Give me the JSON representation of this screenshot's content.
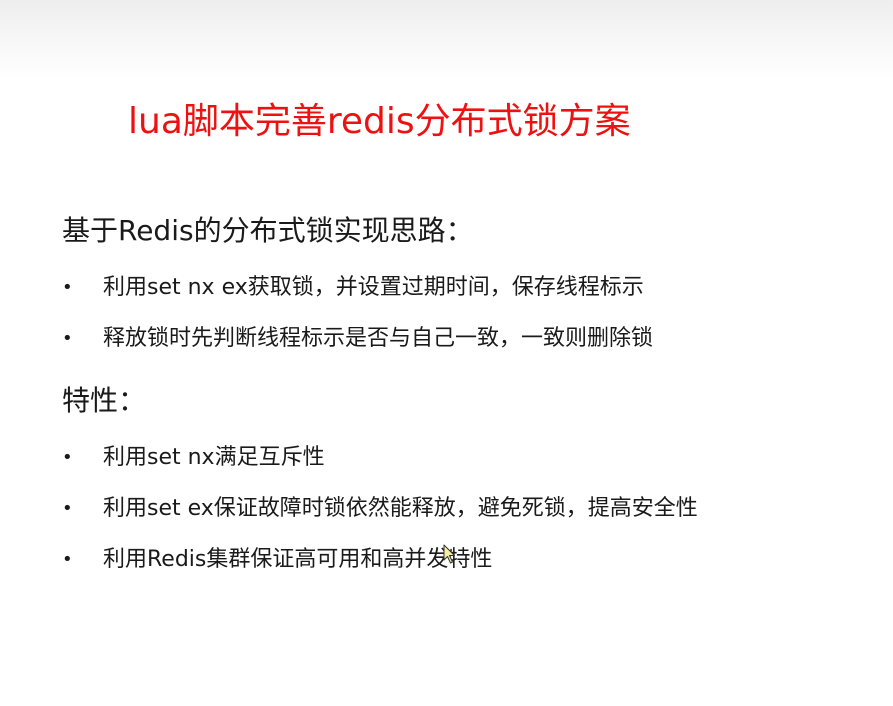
{
  "slide": {
    "title": "lua脚本完善redis分布式锁方案",
    "sections": [
      {
        "heading": "基于Redis的分布式锁实现思路：",
        "bullets": [
          "利用set nx ex获取锁，并设置过期时间，保存线程标示",
          "释放锁时先判断线程标示是否与自己一致，一致则删除锁"
        ]
      },
      {
        "heading": "特性：",
        "bullets": [
          "利用set nx满足互斥性",
          "利用set ex保证故障时锁依然能释放，避免死锁，提高安全性",
          "利用Redis集群保证高可用和高并发特性"
        ]
      }
    ]
  },
  "bullet_glyph": "•",
  "colors": {
    "title": "#ee1111",
    "text": "#1a1a1a",
    "background": "#ffffff"
  },
  "icons": {
    "cursor": "mouse-pointer-arrow-icon"
  }
}
